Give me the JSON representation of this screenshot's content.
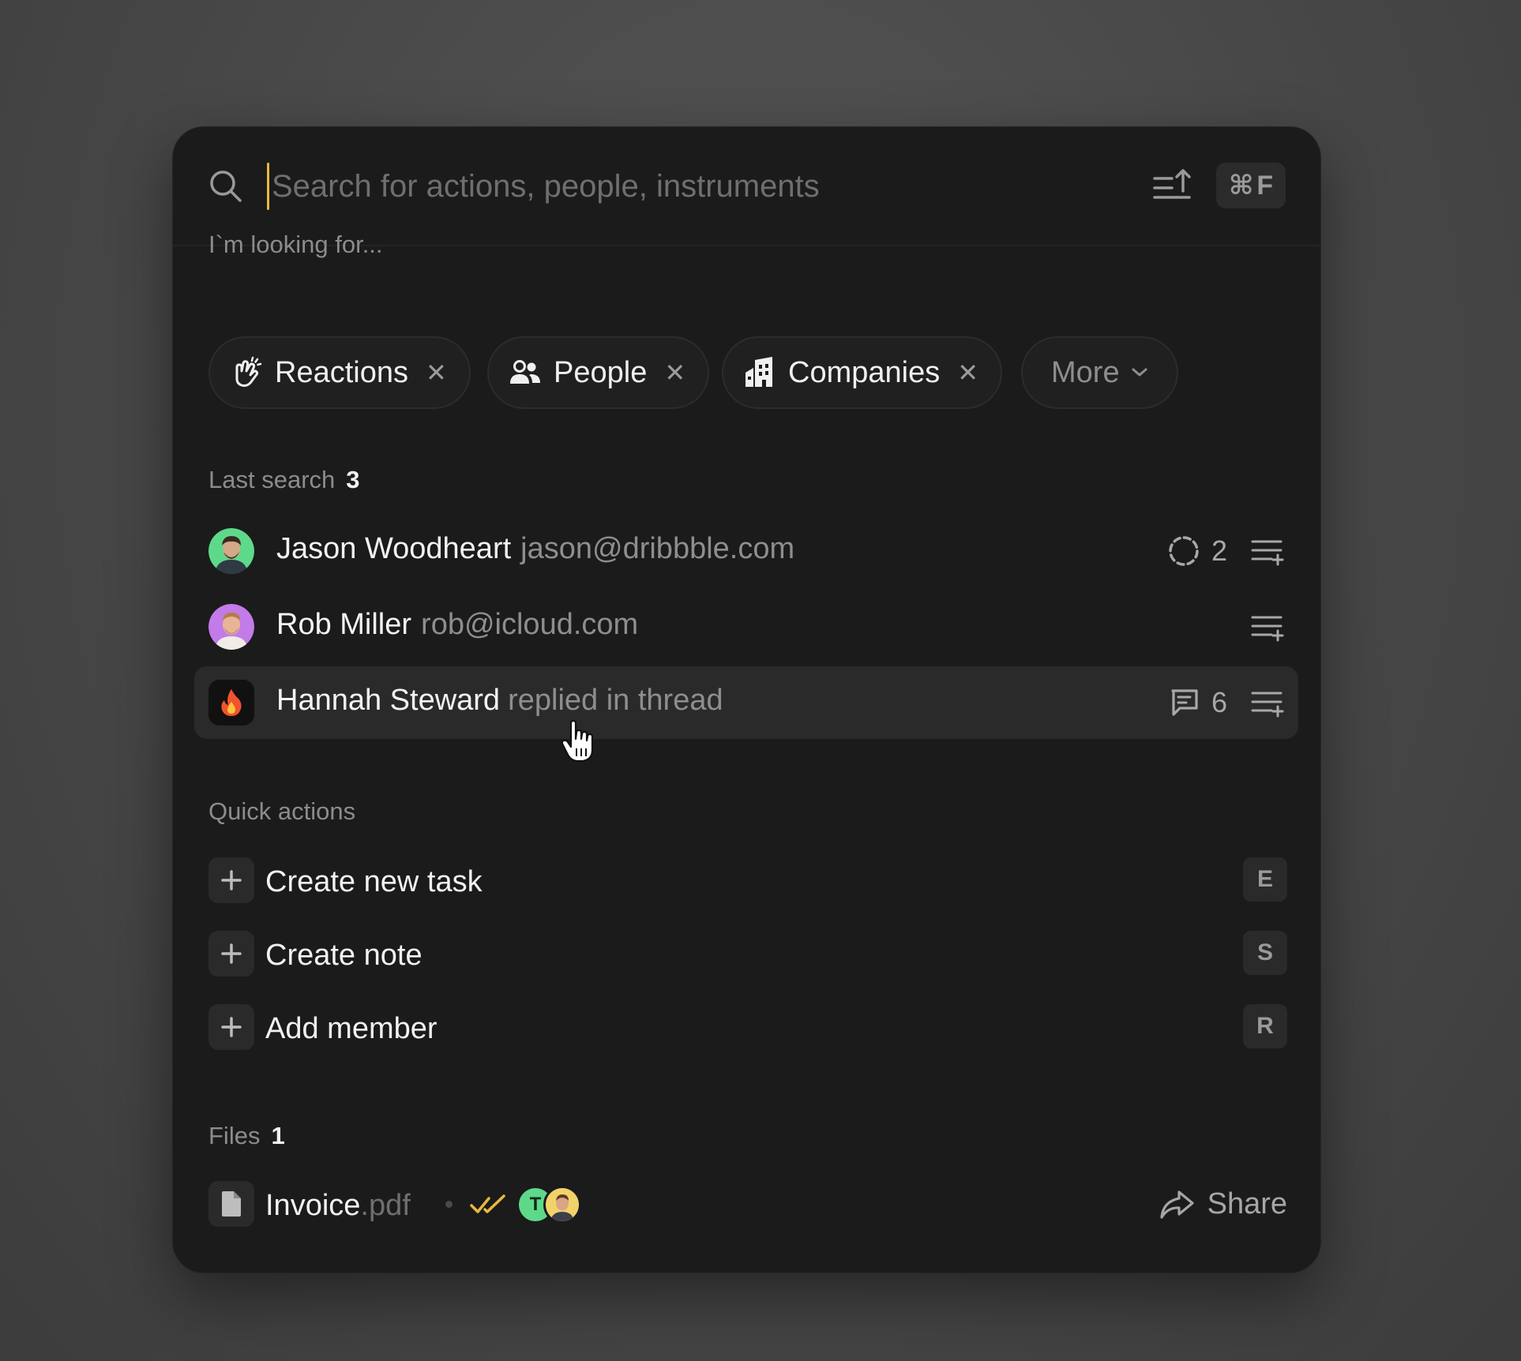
{
  "search": {
    "placeholder": "Search for actions, people, instruments",
    "shortcut_symbol": "⌘",
    "shortcut_key": "F"
  },
  "filters": {
    "label": "I`m looking for...",
    "chips": [
      {
        "label": "Reactions",
        "icon": "clapping-hands-icon"
      },
      {
        "label": "People",
        "icon": "people-icon"
      },
      {
        "label": "Companies",
        "icon": "building-icon"
      }
    ],
    "more_label": "More"
  },
  "last_search": {
    "label": "Last search",
    "count": "3",
    "items": [
      {
        "name": "Jason Woodheart",
        "detail": "jason@dribbble.com",
        "meta_count": "2",
        "meta_icon": "loading-circle-icon"
      },
      {
        "name": "Rob Miller",
        "detail": "rob@icloud.com"
      },
      {
        "name": "Hannah Steward",
        "detail": "replied in thread",
        "meta_count": "6",
        "meta_icon": "comment-icon"
      }
    ]
  },
  "quick_actions": {
    "label": "Quick actions",
    "items": [
      {
        "label": "Create new task",
        "key": "E"
      },
      {
        "label": "Create note",
        "key": "S"
      },
      {
        "label": "Add member",
        "key": "R"
      }
    ]
  },
  "files": {
    "label": "Files",
    "count": "1",
    "items": [
      {
        "name": "Invoice",
        "ext": ".pdf",
        "avatar_initial": "T",
        "share_label": "Share"
      }
    ]
  },
  "colors": {
    "accent": "#e9b93a",
    "check": "#e9b93a",
    "avatar_green": "#5ed98a"
  }
}
